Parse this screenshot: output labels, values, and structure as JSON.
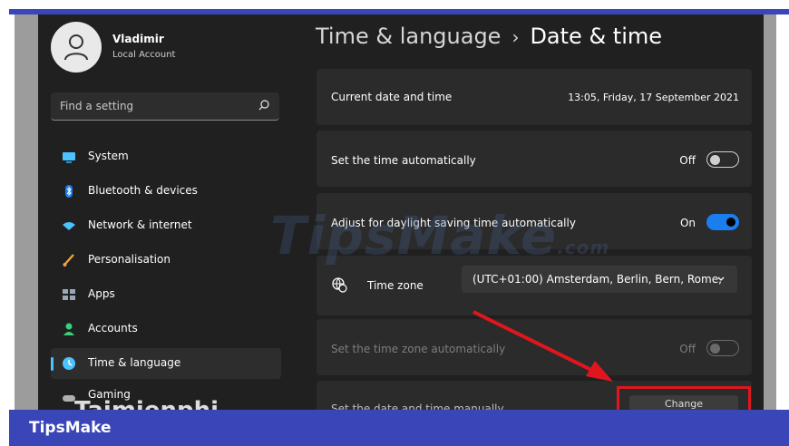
{
  "user": {
    "name": "Vladimir",
    "account_type": "Local Account"
  },
  "search": {
    "placeholder": "Find a setting"
  },
  "nav": [
    {
      "label": "System",
      "icon": "monitor-icon",
      "color": "#4cc2ff"
    },
    {
      "label": "Bluetooth & devices",
      "icon": "bluetooth-icon",
      "color": "#1a7ef0"
    },
    {
      "label": "Network & internet",
      "icon": "wifi-icon",
      "color": "#4cc2ff"
    },
    {
      "label": "Personalisation",
      "icon": "brush-icon",
      "color": "#f2a33a"
    },
    {
      "label": "Apps",
      "icon": "apps-icon",
      "color": "#9aa7b8"
    },
    {
      "label": "Accounts",
      "icon": "person-icon",
      "color": "#3ccf7a"
    },
    {
      "label": "Time & language",
      "icon": "globe-clock-icon",
      "color": "#4cc2ff",
      "active": true
    },
    {
      "label": "Gaming",
      "icon": "gamepad-icon",
      "color": "#b0b0b0"
    }
  ],
  "breadcrumb": {
    "parent": "Time & language",
    "separator": "›",
    "current": "Date & time"
  },
  "settings": {
    "current": {
      "label": "Current date and time",
      "value": "13:05, Friday, 17 September 2021"
    },
    "set_auto": {
      "label": "Set the time automatically",
      "state": "Off"
    },
    "dst": {
      "label": "Adjust for daylight saving time automatically",
      "state": "On"
    },
    "timezone": {
      "label": "Time zone",
      "value": "(UTC+01:00) Amsterdam, Berlin, Bern, Rome,"
    },
    "tz_auto": {
      "label": "Set the time zone automatically",
      "state": "Off"
    },
    "manual": {
      "label": "Set the date and time manually",
      "button": "Change"
    }
  },
  "watermark": {
    "text": "TipsMake",
    "suffix": ".com",
    "text2": "Taimienphi"
  },
  "footer": {
    "brand": "TipsMake"
  },
  "colors": {
    "accent": "#1a7ef0",
    "annotation": "#e0161e",
    "brand_bar": "#3a45b8"
  }
}
